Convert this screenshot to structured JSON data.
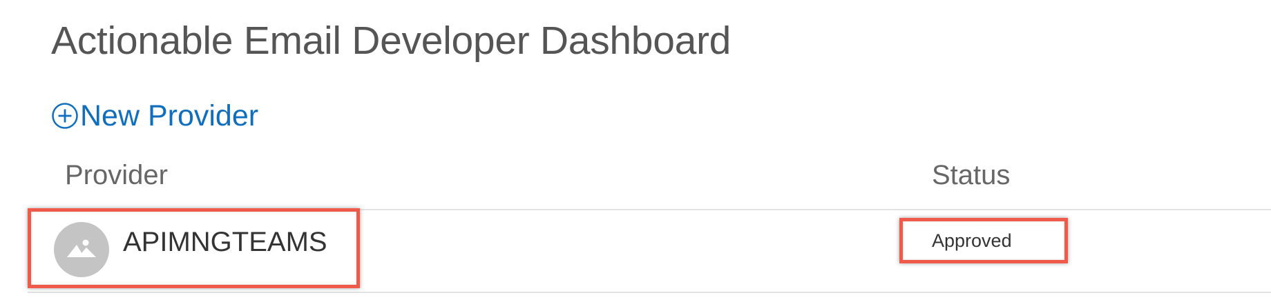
{
  "header": {
    "title": "Actionable Email Developer Dashboard"
  },
  "actions": {
    "new_provider_label": "New Provider",
    "new_provider_icon": "plus-circle-icon"
  },
  "table": {
    "columns": [
      "Provider",
      "Status"
    ],
    "rows": [
      {
        "avatar_icon": "image-placeholder-icon",
        "provider": "APIMNGTEAMS",
        "status": "Approved"
      }
    ]
  },
  "colors": {
    "link": "#106ebe",
    "title": "#555555",
    "highlight": "#f05a4a",
    "avatar": "#c4c4c4",
    "divider": "#e1e1e1"
  }
}
